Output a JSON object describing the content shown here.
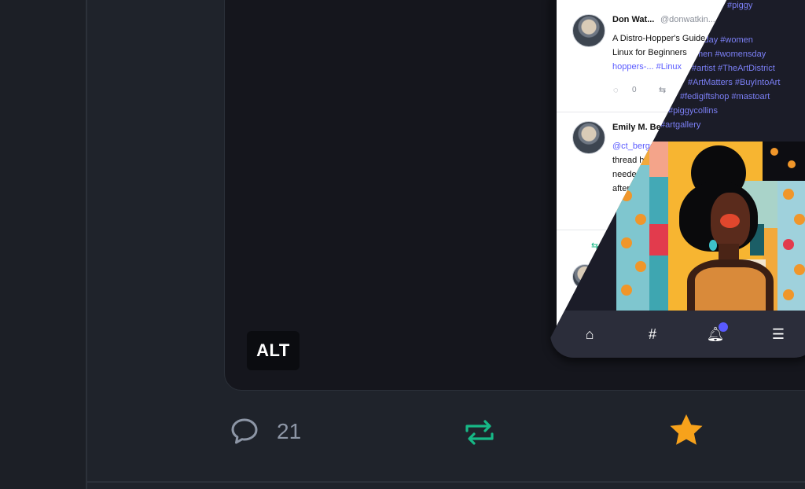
{
  "media": {
    "alt_label": "ALT"
  },
  "phone_screenshot": {
    "top_fragment": "#piggy",
    "post1": {
      "name": "Don Wat...",
      "handle": "@donwatkin...",
      "line1": "A Distro-Hopper's Guide",
      "line2": "Linux for Beginners",
      "line3": "hoppers-... #Linux",
      "reply_count": "0"
    },
    "post2": {
      "name": "Emily M. Bender",
      "line1": "@ct_berger",
      "line2": "thread he...",
      "line3": "needed",
      "line4": "after..."
    },
    "overlay_tags": [
      "#piggy",
      "sday #women",
      "men #womensday",
      "#artist #TheArtDistrict",
      "#ArtMatters #BuyIntoArt",
      "#fedigiftshop #mastoart",
      "#piggycollins",
      "#artgallery"
    ]
  },
  "actions": {
    "reply_count": "21",
    "reply_icon": "speech-bubble",
    "boost_icon": "repeat-arrows",
    "favourite_icon": "star",
    "boost_color": "#17b886",
    "favourite_color": "#f7a21b"
  }
}
